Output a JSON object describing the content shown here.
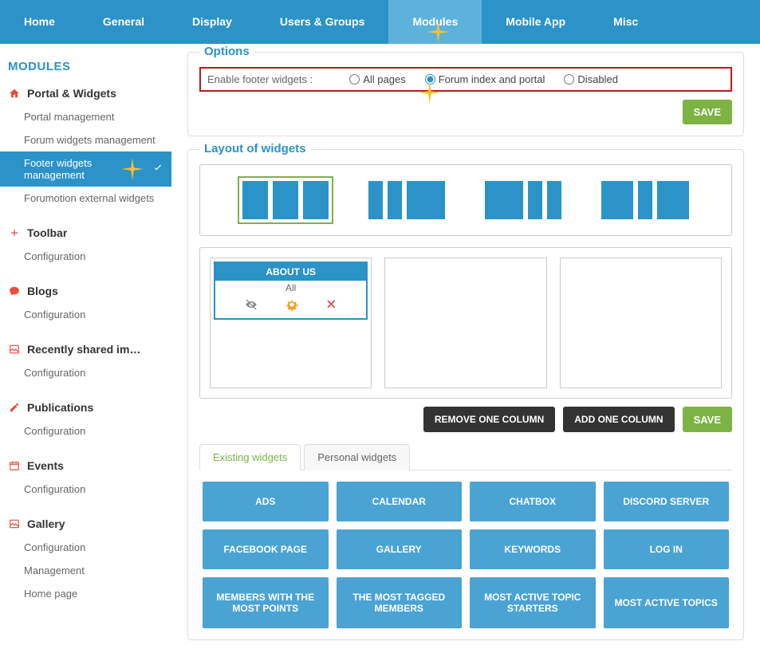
{
  "topnav": {
    "items": [
      "Home",
      "General",
      "Display",
      "Users & Groups",
      "Modules",
      "Mobile App",
      "Misc"
    ],
    "active_index": 4
  },
  "sidebar": {
    "title": "MODULES",
    "sections": [
      {
        "icon": "home",
        "icon_color": "#e74c3c",
        "heading": "Portal & Widgets",
        "items": [
          {
            "label": "Portal management",
            "active": false
          },
          {
            "label": "Forum widgets management",
            "active": false
          },
          {
            "label": "Footer widgets management",
            "active": true
          },
          {
            "label": "Forumotion external widgets",
            "active": false
          }
        ]
      },
      {
        "icon": "plus",
        "icon_color": "#e74c3c",
        "heading": "Toolbar",
        "items": [
          {
            "label": "Configuration"
          }
        ]
      },
      {
        "icon": "chat",
        "icon_color": "#e74c3c",
        "heading": "Blogs",
        "items": [
          {
            "label": "Configuration"
          }
        ]
      },
      {
        "icon": "image",
        "icon_color": "#e74c3c",
        "heading": "Recently shared im…",
        "items": [
          {
            "label": "Configuration"
          }
        ]
      },
      {
        "icon": "pencil",
        "icon_color": "#e74c3c",
        "heading": "Publications",
        "items": [
          {
            "label": "Configuration"
          }
        ]
      },
      {
        "icon": "calendar",
        "icon_color": "#e74c3c",
        "heading": "Events",
        "items": [
          {
            "label": "Configuration"
          }
        ]
      },
      {
        "icon": "image",
        "icon_color": "#e74c3c",
        "heading": "Gallery",
        "items": [
          {
            "label": "Configuration"
          },
          {
            "label": "Management"
          },
          {
            "label": "Home page"
          }
        ]
      }
    ]
  },
  "options_panel": {
    "title": "Options",
    "label": "Enable footer widgets :",
    "radios": [
      {
        "label": "All pages",
        "checked": false
      },
      {
        "label": "Forum index and portal",
        "checked": true
      },
      {
        "label": "Disabled",
        "checked": false
      }
    ],
    "save_label": "SAVE"
  },
  "layout_panel": {
    "title": "Layout of widgets",
    "presets": [
      {
        "cols": [
          32,
          32,
          32
        ],
        "selected": true
      },
      {
        "cols": [
          18,
          18,
          60
        ],
        "selected": false
      },
      {
        "cols": [
          60,
          18,
          18
        ],
        "selected": false
      },
      {
        "cols": [
          44,
          18,
          44
        ],
        "selected": false
      }
    ],
    "zones": [
      {
        "widgets": [
          {
            "title": "ABOUT US",
            "meta": "All"
          }
        ]
      },
      {
        "widgets": []
      },
      {
        "widgets": []
      }
    ],
    "remove_col_label": "REMOVE ONE COLUMN",
    "add_col_label": "ADD ONE COLUMN",
    "save_label": "SAVE"
  },
  "widget_tabs": {
    "tabs": [
      "Existing widgets",
      "Personal widgets"
    ],
    "active_index": 0,
    "tiles": [
      "ADS",
      "CALENDAR",
      "CHATBOX",
      "DISCORD SERVER",
      "FACEBOOK PAGE",
      "GALLERY",
      "KEYWORDS",
      "LOG IN",
      "MEMBERS WITH THE MOST POINTS",
      "THE MOST TAGGED MEMBERS",
      "MOST ACTIVE TOPIC STARTERS",
      "MOST ACTIVE TOPICS"
    ]
  }
}
